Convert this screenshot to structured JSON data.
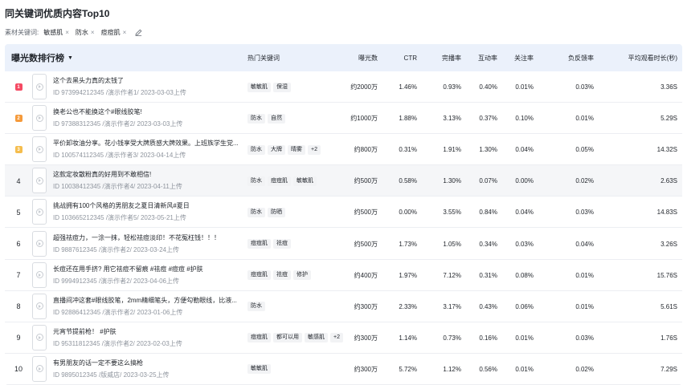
{
  "title": "同关键词优质内容Top10",
  "filters": {
    "label": "素材关键词:",
    "chips": [
      "敏感肌",
      "防水",
      "痘痘肌"
    ],
    "close_glyph": "×"
  },
  "table": {
    "sort_title": "曝光数排行榜",
    "sort_caret": "▼",
    "headers": {
      "keywords": "热门关键词",
      "exposure": "曝光数",
      "ctr": "CTR",
      "completion": "完播率",
      "interaction": "互动率",
      "follow": "关注率",
      "negative": "负反馈率",
      "avg_time": "平均观看时长(秒)"
    },
    "medal_colors": [
      "#f54a63",
      "#f59a3b",
      "#f5bd4d"
    ],
    "rows": [
      {
        "rank": "1",
        "medal": true,
        "title": "这个去黑头力真的太钱了",
        "meta": "ID 973994212345 /演示作者1/ 2023-03-03上传",
        "tags": [
          "敏敏肌",
          "保湿"
        ],
        "exposure": "约2000万",
        "ctr": "1.46%",
        "completion": "0.93%",
        "interaction": "0.40%",
        "follow": "0.01%",
        "negative": "0.03%",
        "avg_time": "3.36S"
      },
      {
        "rank": "2",
        "medal": true,
        "title": "换老公也不能换这个#眼线胶笔!",
        "meta": "ID 97388312345 /演示作者2/ 2023-03-03上传",
        "tags": [
          "防水",
          "自然"
        ],
        "exposure": "约1000万",
        "ctr": "1.88%",
        "completion": "3.13%",
        "interaction": "0.37%",
        "follow": "0.10%",
        "negative": "0.01%",
        "avg_time": "5.29S"
      },
      {
        "rank": "3",
        "medal": true,
        "title": "平价卸妆油分享。花小钱享受大牌质感大牌效果。上班族学生党...",
        "meta": "ID 100574112345 /演示作者3/ 2023-04-14上传",
        "tags": [
          "防水",
          "大牌",
          "晴雾",
          "+2"
        ],
        "exposure": "约800万",
        "ctr": "0.31%",
        "completion": "1.91%",
        "interaction": "1.30%",
        "follow": "0.04%",
        "negative": "0.05%",
        "avg_time": "14.32S"
      },
      {
        "rank": "4",
        "medal": false,
        "title": "这款定妆散粉真的好用到不敢相信!",
        "meta": "ID 10038412345 /演示作者4/ 2023-04-11上传",
        "tags": [
          "防水",
          "痘痘肌",
          "敏敏肌"
        ],
        "exposure": "约500万",
        "ctr": "0.58%",
        "completion": "1.30%",
        "interaction": "0.07%",
        "follow": "0.00%",
        "negative": "0.02%",
        "avg_time": "2.63S"
      },
      {
        "rank": "5",
        "medal": false,
        "title": "挑战拥有100个风格的男朋友之夏日清新风#夏日",
        "meta": "ID 103665212345 /演示作者5/ 2023-05-21上传",
        "tags": [
          "防水",
          "防晒"
        ],
        "exposure": "约500万",
        "ctr": "0.00%",
        "completion": "3.55%",
        "interaction": "0.84%",
        "follow": "0.04%",
        "negative": "0.03%",
        "avg_time": "14.83S"
      },
      {
        "rank": "6",
        "medal": false,
        "title": "超强祛痘力，一涂一抹，轻松祛痘淡印！不花冤枉钱！！！",
        "meta": "ID 9887612345 /演示作者2/ 2023-03-24上传",
        "tags": [
          "痘痘肌",
          "祛痘"
        ],
        "exposure": "约500万",
        "ctr": "1.73%",
        "completion": "1.05%",
        "interaction": "0.34%",
        "follow": "0.03%",
        "negative": "0.04%",
        "avg_time": "3.26S"
      },
      {
        "rank": "7",
        "medal": false,
        "title": "长痘还在用手挤? 用它祛痘不留痕 #祛痘 #痘痘 #护肤",
        "meta": "ID 9994912345 /演示作者2/ 2023-04-06上传",
        "tags": [
          "痘痘肌",
          "祛痘",
          "修护"
        ],
        "exposure": "约400万",
        "ctr": "1.97%",
        "completion": "7.12%",
        "interaction": "0.31%",
        "follow": "0.08%",
        "negative": "0.01%",
        "avg_time": "15.76S"
      },
      {
        "rank": "8",
        "medal": false,
        "title": "直播间冲这套#眼线胶笔，2mm精细笔头，方便勾勒眼线，比液...",
        "meta": "ID 92886412345 /演示作者2/ 2023-01-06上传",
        "tags": [
          "防水"
        ],
        "exposure": "约300万",
        "ctr": "2.33%",
        "completion": "3.17%",
        "interaction": "0.43%",
        "follow": "0.06%",
        "negative": "0.01%",
        "avg_time": "5.61S"
      },
      {
        "rank": "9",
        "medal": false,
        "title": "元宵节提前枪！ #护肤",
        "meta": "ID 95311812345 /演示作者2/ 2023-02-03上传",
        "tags": [
          "痘痘肌",
          "都可以用",
          "敏感肌",
          "+2"
        ],
        "exposure": "约300万",
        "ctr": "1.14%",
        "completion": "0.73%",
        "interaction": "0.16%",
        "follow": "0.01%",
        "negative": "0.03%",
        "avg_time": "1.76S"
      },
      {
        "rank": "10",
        "medal": false,
        "title": "有男朋友的话一定不要这么搞枪",
        "meta": "ID 9895012345 /版威店/ 2023-03-25上传",
        "tags": [
          "敏敏肌"
        ],
        "exposure": "约300万",
        "ctr": "5.72%",
        "completion": "1.12%",
        "interaction": "0.56%",
        "follow": "0.01%",
        "negative": "0.02%",
        "avg_time": "7.29S"
      }
    ]
  }
}
